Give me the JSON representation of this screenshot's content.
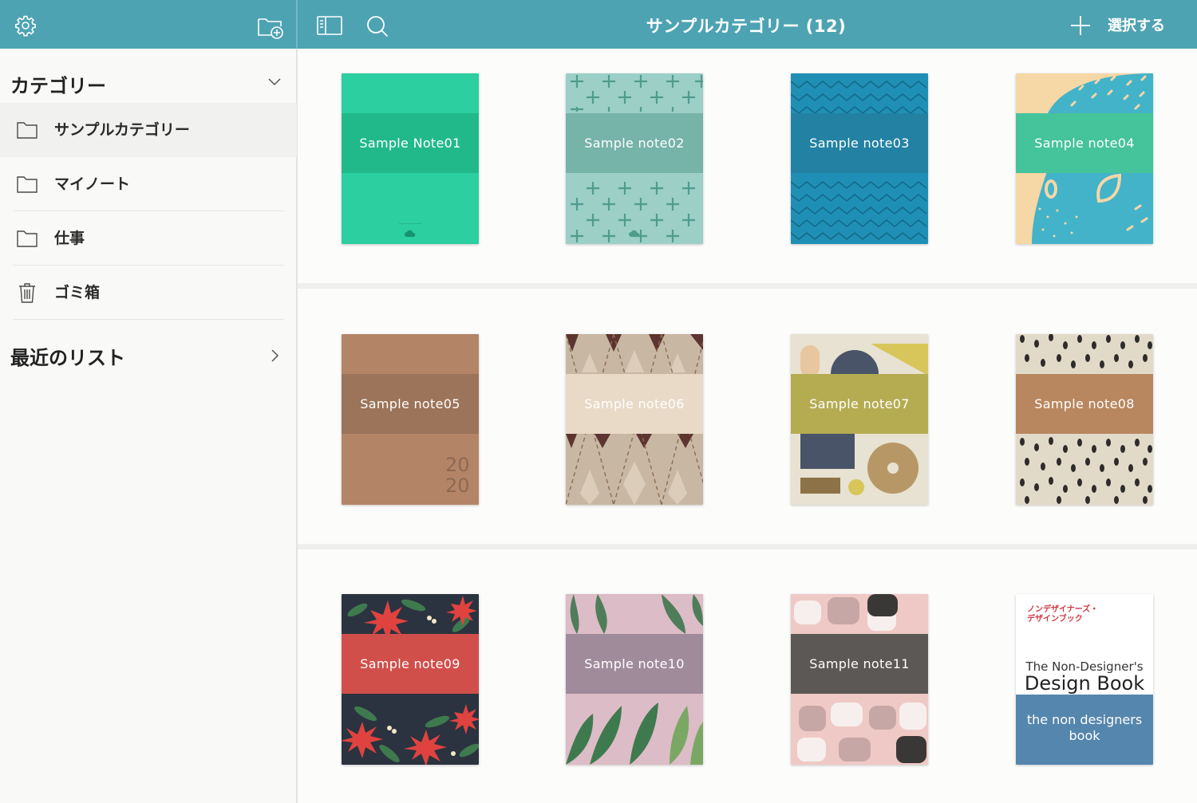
{
  "header": {
    "title": "サンプルカテゴリー (12)",
    "select_label": "選択する"
  },
  "sidebar": {
    "category_heading": "カテゴリー",
    "items": [
      {
        "label": "サンプルカテゴリー",
        "icon": "folder-icon",
        "active": true
      },
      {
        "label": "マイノート",
        "icon": "folder-icon",
        "active": false
      },
      {
        "label": "仕事",
        "icon": "folder-icon",
        "active": false
      },
      {
        "label": "ゴミ箱",
        "icon": "trash-icon",
        "active": false
      }
    ],
    "recent_heading": "最近のリスト"
  },
  "notes": [
    {
      "title": "Sample Note01"
    },
    {
      "title": "Sample note02"
    },
    {
      "title": "Sample note03"
    },
    {
      "title": "Sample note04"
    },
    {
      "title": "Sample note05",
      "cover_text": [
        "20",
        "20"
      ]
    },
    {
      "title": "Sample note06"
    },
    {
      "title": "Sample note07"
    },
    {
      "title": "Sample note08"
    },
    {
      "title": "Sample note09"
    },
    {
      "title": "Sample note10"
    },
    {
      "title": "Sample note11"
    },
    {
      "jp_title": [
        "ノンデザイナーズ・",
        "デザインブック"
      ],
      "subtitle": "The Non-Designer's",
      "title": "Design Book",
      "band_text": "the non designers book"
    }
  ],
  "colors": {
    "header": "#4ea3b3",
    "note01": "#2ccf9f",
    "note02": "#9ccfc6",
    "note03": "#1f8fb5",
    "note04": "#43b3c9",
    "note05": "#b48467",
    "note06": "#c8b8a3",
    "note07": "#e7e2d1",
    "note08": "#e2dac9",
    "note09": "#2b3340",
    "note10": "#dcbcc6",
    "note11": "#efc9c5",
    "book_band": "#5586ad"
  }
}
